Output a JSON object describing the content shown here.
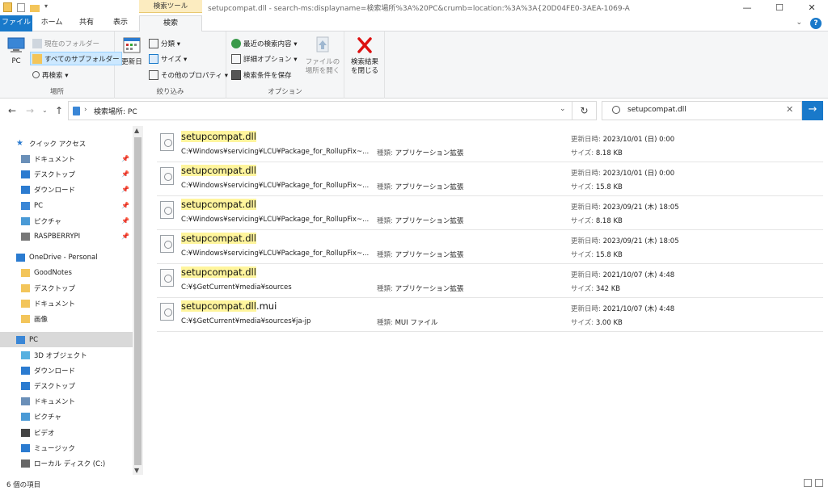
{
  "window": {
    "context_group": "検索ツール",
    "title": "setupcompat.dll - search-ms:displayname=検索場所%3A%20PC&crumb=location:%3A%3A{20D04FE0-3AEA-1069-A",
    "buttons": {
      "minimize": "—",
      "maximize": "☐",
      "close": "✕"
    }
  },
  "tabs": [
    {
      "label": "ファイル"
    },
    {
      "label": "ホーム"
    },
    {
      "label": "共有"
    },
    {
      "label": "表示"
    },
    {
      "label": "検索"
    }
  ],
  "help": "?",
  "ribbon": {
    "location": {
      "group_label": "場所",
      "pc": "PC",
      "current_folder": "現在のフォルダー",
      "all_subfolders": "すべてのサブフォルダー",
      "search_again": "再検索 ▾"
    },
    "refine": {
      "group_label": "絞り込み",
      "date_modified": "更新日",
      "kind": "分類 ▾",
      "size": "サイズ ▾",
      "other_properties": "その他のプロパティ ▾"
    },
    "options": {
      "group_label": "オプション",
      "recent_searches": "最近の検索内容 ▾",
      "advanced_options": "詳細オプション ▾",
      "save_search": "検索条件を保存",
      "open_file_location": [
        "ファイルの",
        "場所を開く"
      ]
    },
    "close": {
      "label": [
        "検索結果",
        "を閉じる"
      ]
    }
  },
  "address": {
    "path": "検索場所: PC",
    "search_value": "setupcompat.dll"
  },
  "nav": {
    "items": [
      {
        "label": "クイック アクセス",
        "icon": "star-icon",
        "pinned": false
      },
      {
        "label": "ドキュメント",
        "icon": "documents-icon",
        "pinned": true
      },
      {
        "label": "デスクトップ",
        "icon": "desktop-icon",
        "pinned": true
      },
      {
        "label": "ダウンロード",
        "icon": "download-icon",
        "pinned": true
      },
      {
        "label": "PC",
        "icon": "pc-icon",
        "pinned": true
      },
      {
        "label": "ピクチャ",
        "icon": "pictures-icon",
        "pinned": true
      },
      {
        "label": "RASPBERRYPI",
        "icon": "network-drive-icon",
        "pinned": true
      },
      {
        "label": "OneDrive - Personal",
        "icon": "cloud-icon",
        "pinned": false
      },
      {
        "label": "GoodNotes",
        "icon": "folder-icon",
        "pinned": false
      },
      {
        "label": "デスクトップ",
        "icon": "folder-icon",
        "pinned": false
      },
      {
        "label": "ドキュメント",
        "icon": "folder-icon",
        "pinned": false
      },
      {
        "label": "画像",
        "icon": "folder-icon",
        "pinned": false
      },
      {
        "label": "PC",
        "icon": "pc-icon",
        "pinned": false
      },
      {
        "label": "3D オブジェクト",
        "icon": "3d-objects-icon",
        "pinned": false
      },
      {
        "label": "ダウンロード",
        "icon": "download-icon",
        "pinned": false
      },
      {
        "label": "デスクトップ",
        "icon": "desktop-icon",
        "pinned": false
      },
      {
        "label": "ドキュメント",
        "icon": "documents-icon",
        "pinned": false
      },
      {
        "label": "ピクチャ",
        "icon": "pictures-icon",
        "pinned": false
      },
      {
        "label": "ビデオ",
        "icon": "video-icon",
        "pinned": false
      },
      {
        "label": "ミュージック",
        "icon": "music-icon",
        "pinned": false
      },
      {
        "label": "ローカル ディスク (C:)",
        "icon": "drive-icon",
        "pinned": false
      }
    ],
    "pin_glyph": "📌"
  },
  "labels": {
    "type": "種類:",
    "modified": "更新日時:",
    "size": "サイズ:"
  },
  "results": [
    {
      "name_hl": "setupcompat.dll",
      "name_rest": "",
      "path": "C:¥Windows¥servicing¥LCU¥Package_for_RollupFix~...",
      "type": "アプリケーション拡張",
      "date": "2023/10/01 (日) 0:00",
      "size": "8.18 KB"
    },
    {
      "name_hl": "setupcompat.dll",
      "name_rest": "",
      "path": "C:¥Windows¥servicing¥LCU¥Package_for_RollupFix~...",
      "type": "アプリケーション拡張",
      "date": "2023/10/01 (日) 0:00",
      "size": "15.8 KB"
    },
    {
      "name_hl": "setupcompat.dll",
      "name_rest": "",
      "path": "C:¥Windows¥servicing¥LCU¥Package_for_RollupFix~...",
      "type": "アプリケーション拡張",
      "date": "2023/09/21 (木) 18:05",
      "size": "8.18 KB"
    },
    {
      "name_hl": "setupcompat.dll",
      "name_rest": "",
      "path": "C:¥Windows¥servicing¥LCU¥Package_for_RollupFix~...",
      "type": "アプリケーション拡張",
      "date": "2023/09/21 (木) 18:05",
      "size": "15.8 KB"
    },
    {
      "name_hl": "setupcompat.dll",
      "name_rest": "",
      "path": "C:¥$GetCurrent¥media¥sources",
      "type": "アプリケーション拡張",
      "date": "2021/10/07 (木) 4:48",
      "size": "342 KB"
    },
    {
      "name_hl": "setupcompat.dll",
      "name_rest": ".mui",
      "path": "C:¥$GetCurrent¥media¥sources¥ja-jp",
      "type": "MUI ファイル",
      "date": "2021/10/07 (木) 4:48",
      "size": "3.00 KB"
    }
  ],
  "status": {
    "count": "6 個の項目"
  },
  "colors": {
    "accent": "#1979ca",
    "highlight": "#fff59d",
    "context_tab": "#fcecc0"
  }
}
